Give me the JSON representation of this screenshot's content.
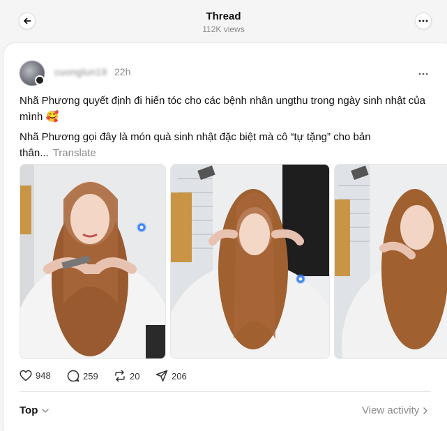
{
  "header": {
    "title": "Thread",
    "views": "112K views"
  },
  "post": {
    "username": "cuonglun19",
    "time": "22h",
    "text_line1": "Nhã Phương quyết định đi hiến tóc cho các bệnh nhân ungthu trong ngày sinh nhật của mình 🥰",
    "text_line2": "Nhã Phương gọi đây là món quà sinh nhật đặc biệt mà cô “tự tặng” cho bản thân...",
    "translate": "Translate"
  },
  "actions": {
    "likes": "948",
    "comments": "259",
    "reposts": "20",
    "shares": "206"
  },
  "footer": {
    "sort_label": "Top",
    "view_activity": "View activity"
  },
  "colors": {
    "accent_cursor": "#3b82f6",
    "muted_text": "#8a8a8a"
  },
  "icons": [
    "back-arrow-icon",
    "more-icon",
    "heart-icon",
    "comment-icon",
    "repost-icon",
    "share-icon",
    "chevron-down-icon",
    "chevron-right-icon"
  ]
}
